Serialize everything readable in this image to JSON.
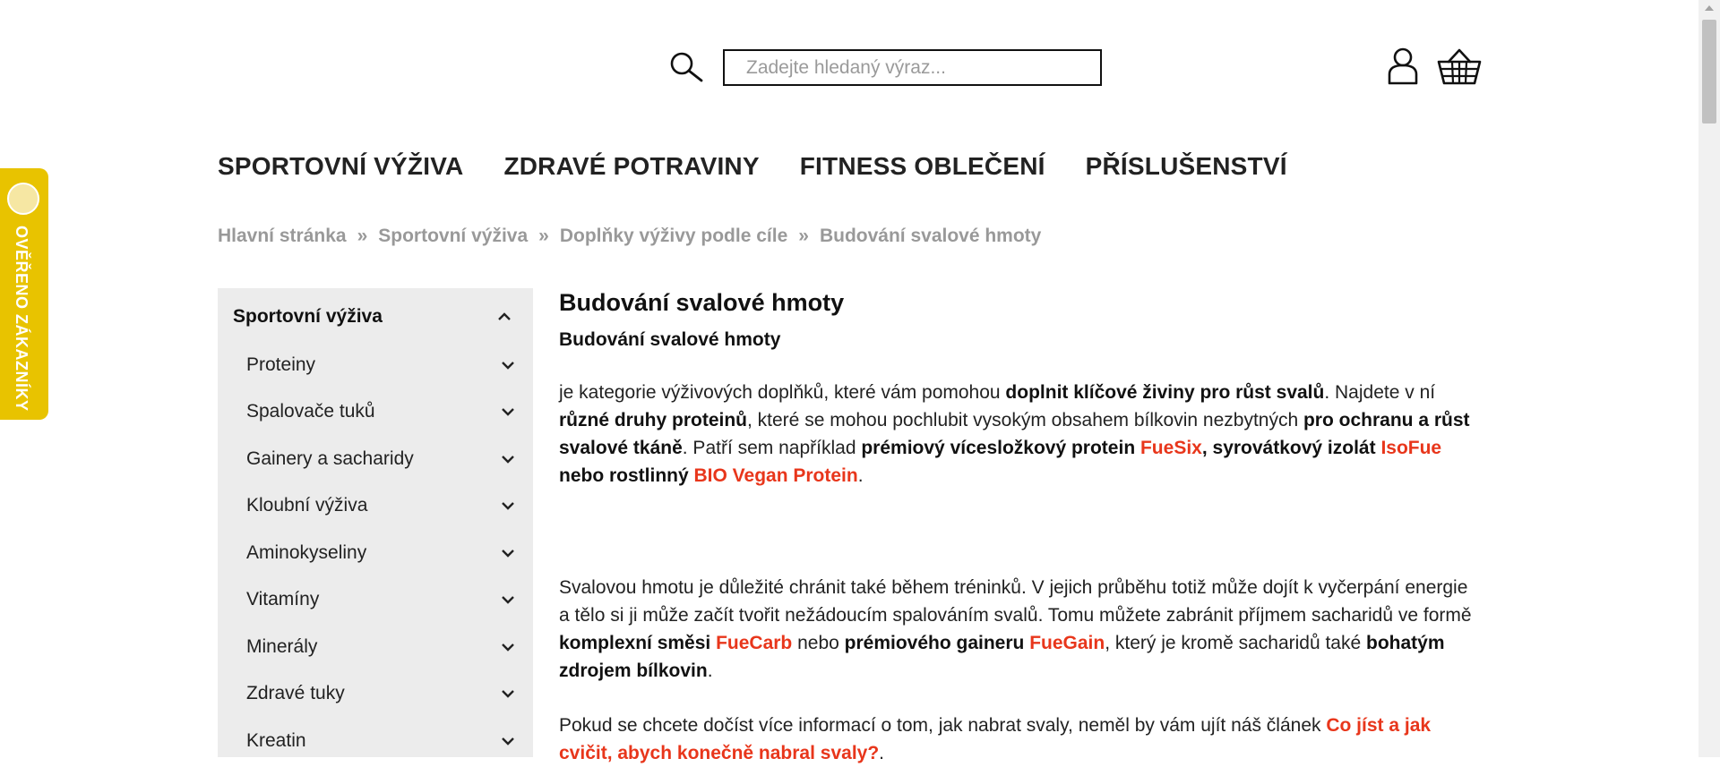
{
  "search": {
    "placeholder": "Zadejte hledaný výraz..."
  },
  "nav": {
    "items": [
      "SPORTOVNÍ VÝŽIVA",
      "ZDRAVÉ POTRAVINY",
      "FITNESS OBLEČENÍ",
      "PŘÍSLUŠENSTVÍ"
    ]
  },
  "breadcrumb": {
    "items": [
      "Hlavní stránka",
      "Sportovní výživa",
      "Doplňky výživy podle cíle",
      "Budování svalové hmoty"
    ],
    "separator": "»"
  },
  "verified": {
    "label": "OVĚŘENO ZÁKAZNÍKY"
  },
  "sidebar": {
    "heading": "Sportovní výživa",
    "items": [
      "Proteiny",
      "Spalovače tuků",
      "Gainery a sacharidy",
      "Kloubní výživa",
      "Aminokyseliny",
      "Vitamíny",
      "Minerály",
      "Zdravé tuky",
      "Kreatin"
    ]
  },
  "content": {
    "title": "Budování svalové hmoty",
    "subtitle": "Budování svalové hmoty",
    "p1": {
      "t1": "je kategorie výživových doplňků, které vám pomohou ",
      "b1": "doplnit klíčové živiny pro růst svalů",
      "t2": ". Najdete v ní ",
      "b2": "různé druhy proteinů",
      "t3": ", které se mohou pochlubit vysokým obsahem bílkovin nezbytných ",
      "b3": "pro ochranu a růst svalové tkáně",
      "t4": ". Patří sem například ",
      "b4": "prémiový vícesložkový protein ",
      "l1": "FueSix",
      "b5": ", syrovátkový izolát ",
      "l2": "IsoFue",
      "b6": " nebo rostlinný ",
      "l3": "BIO Vegan Protein",
      "t5": "."
    },
    "p2": {
      "t1": "Svalovou hmotu je důležité chránit také během tréninků. V jejich průběhu totiž může dojít k vyčerpání energie a tělo si ji může začít tvořit nežádoucím spalováním svalů. Tomu můžete zabránit příjmem sacharidů ve formě ",
      "b1": "komplexní směsi ",
      "l1": "FueCarb",
      "t2": " nebo ",
      "b2": "prémiového gaineru ",
      "l2": "FueGain",
      "t3": ", který je kromě sacharidů také ",
      "b3": "bohatým zdrojem bílkovin",
      "t4": "."
    },
    "p3": {
      "t1": "Pokud se chcete dočíst více informací o tom, jak nabrat svaly, neměl by vám ujít náš článek ",
      "l1": "Co jíst a jak cvičit, abych konečně nabral svaly?",
      "t2": "."
    }
  },
  "colors": {
    "accent": "#e8361b",
    "verified": "#e8c300",
    "sidebar_bg": "#ececec"
  }
}
